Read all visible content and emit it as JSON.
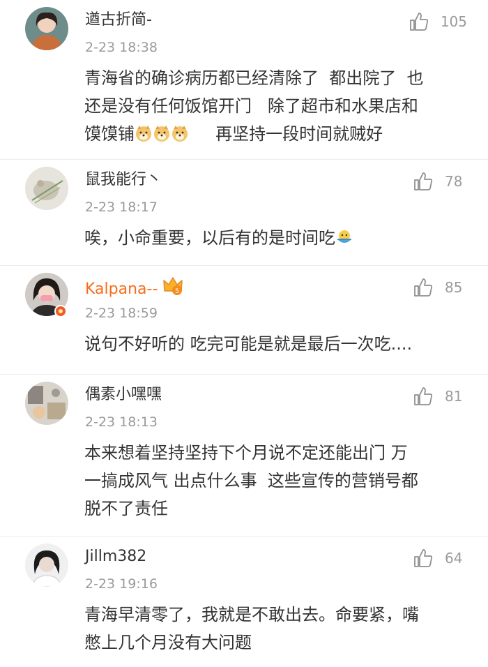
{
  "comments": [
    {
      "username": "遒古折简-",
      "timestamp": "2-23 18:38",
      "likes": "105",
      "content_line1": "青海省的确诊病历都已经清除了  都出院了  也",
      "content_line2": "还是没有任何饭馆开门   除了超市和水果店和",
      "content_line3a": "馍馍铺",
      "content_line3b": "     再坚持一段时间就贼好",
      "emojis": [
        "doge-emoji",
        "doge-emoji",
        "doge-emoji"
      ]
    },
    {
      "username": "鼠我能行丶",
      "timestamp": "2-23 18:17",
      "likes": "78",
      "content_line1": "唉，小命重要，以后有的是时间吃",
      "emojis": [
        "eating-emoji"
      ]
    },
    {
      "username": "Kalpana--",
      "timestamp": "2-23 18:59",
      "likes": "85",
      "content_line1": "说句不好听的 吃完可能是就是最后一次吃....",
      "badges": [
        "vip-crown-icon",
        "verified-badge-icon"
      ]
    },
    {
      "username": "偶素小嘿嘿",
      "timestamp": "2-23 18:13",
      "likes": "81",
      "content_line1": "本来想着坚持坚持下个月说不定还能出门 万",
      "content_line2": "一搞成风气 出点什么事  这些宣传的营销号都",
      "content_line3": "脱不了责任"
    },
    {
      "username": "Jillm382",
      "timestamp": "2-23 19:16",
      "likes": "64",
      "content_line1": "青海早清零了，我就是不敢出去。命要紧，嘴",
      "content_line2": "憋上几个月没有大问题"
    }
  ],
  "icons": {
    "like": "thumbs-up-icon"
  },
  "colors": {
    "text": "#333333",
    "meta": "#9a9a9a",
    "vip_name": "#f86c1a",
    "divider": "#ececec"
  }
}
